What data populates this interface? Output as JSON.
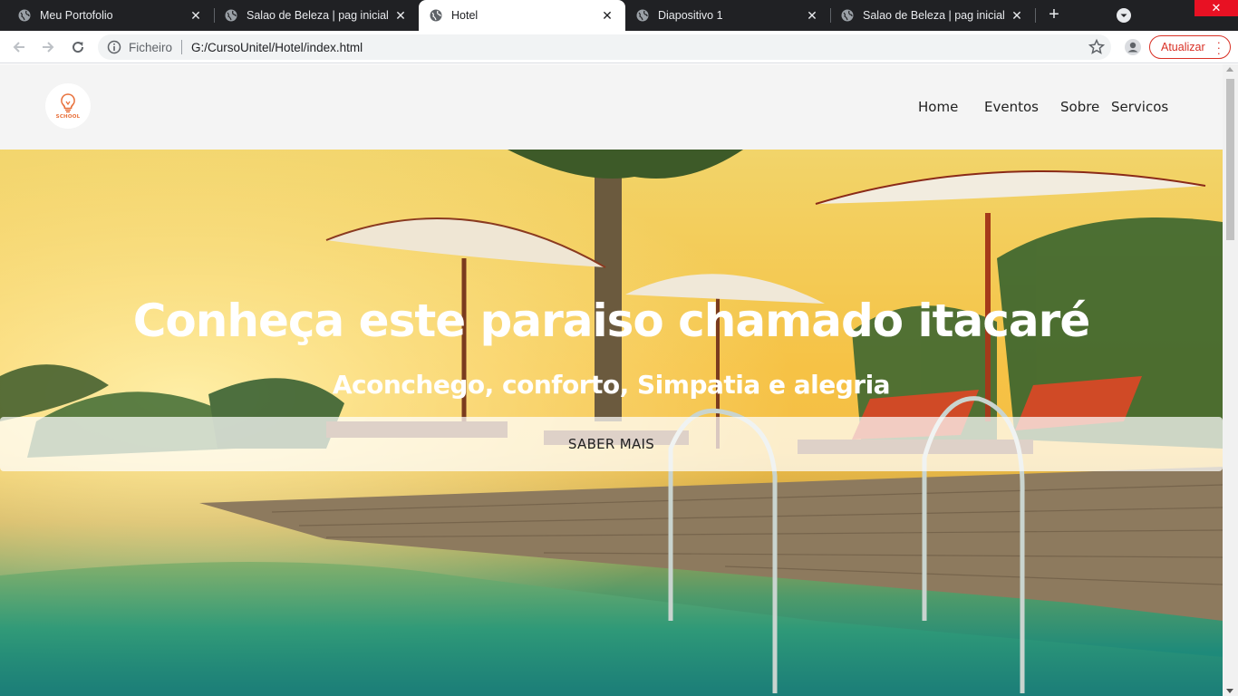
{
  "browser": {
    "tabs": [
      {
        "title": "Meu Portofolio",
        "active": false
      },
      {
        "title": "Salao de Beleza | pag inicial",
        "active": false
      },
      {
        "title": "Hotel",
        "active": true
      },
      {
        "title": "Diapositivo 1",
        "active": false
      },
      {
        "title": "Salao de Beleza | pag inicial",
        "active": false
      }
    ],
    "address": {
      "scheme_label": "Ficheiro",
      "url": "G:/CursoUnitel/Hotel/index.html"
    },
    "update_button_label": "Atualizar",
    "accent_color": "#d93025"
  },
  "site": {
    "logo_text": "SCHOOL",
    "nav": [
      "Home",
      "Eventos",
      "Sobre",
      "Servicos"
    ],
    "hero": {
      "title": "Conheça este paraiso chamado itacaré",
      "subtitle": "Aconchego, conforto, Simpatia e alegria",
      "cta_label": "SABER MAIS"
    }
  }
}
